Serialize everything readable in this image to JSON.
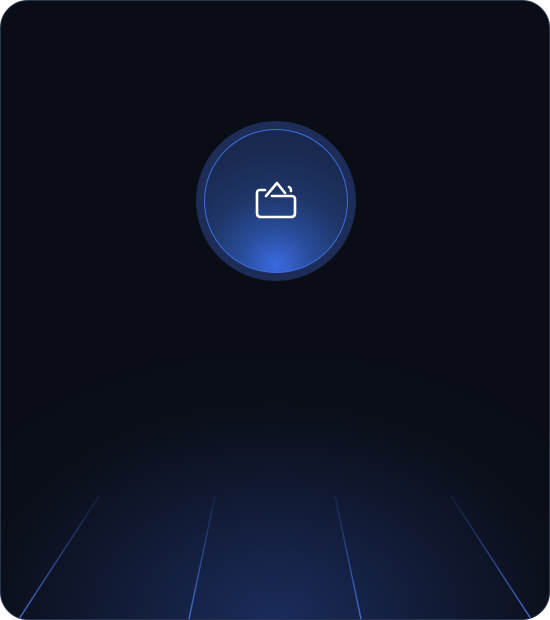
{
  "card": {
    "icon": "folder-open-icon",
    "accent_color": "#3d6fe0",
    "grid_color": "#3a5fc8",
    "background_color": "#0a0d16"
  }
}
